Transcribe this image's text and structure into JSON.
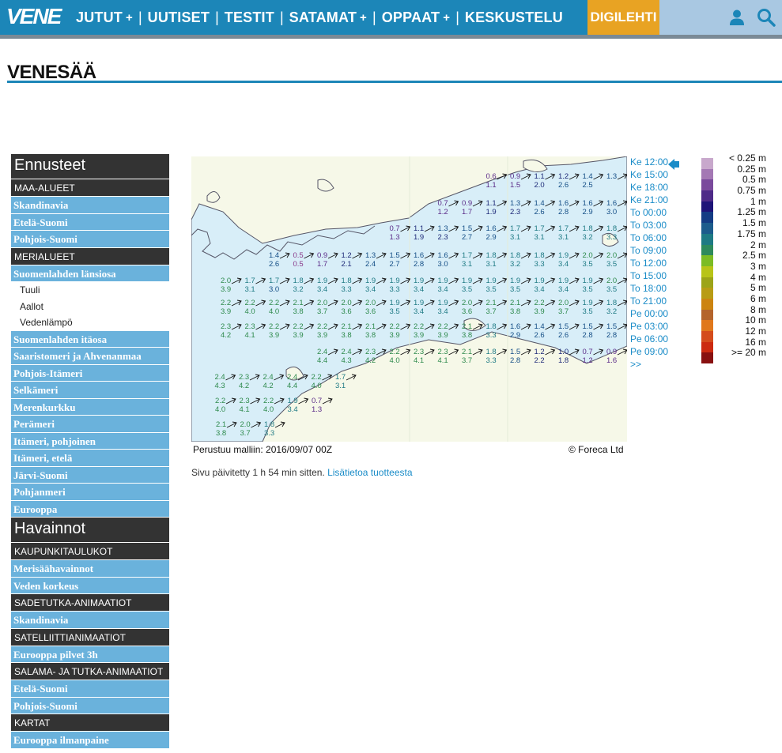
{
  "brand": {
    "logo_text": "VENE",
    "accent": "#1c86b8",
    "cta_color": "#e8a323"
  },
  "nav": {
    "items": [
      {
        "label": "JUTUT",
        "has_submenu": true
      },
      {
        "label": "UUTISET",
        "has_submenu": false
      },
      {
        "label": "TESTIT",
        "has_submenu": false
      },
      {
        "label": "SATAMAT",
        "has_submenu": true
      },
      {
        "label": "OPPAAT",
        "has_submenu": true
      },
      {
        "label": "KESKUSTELU",
        "has_submenu": false
      }
    ],
    "plus_glyph": "+",
    "separator": "|",
    "cta_label": "DIGILEHTI",
    "icons": [
      "user-icon",
      "search-icon"
    ]
  },
  "page": {
    "title": "VENESÄÄ"
  },
  "sidebar": {
    "items": [
      {
        "kind": "head",
        "label": "Ennusteet"
      },
      {
        "kind": "cat",
        "label": "MAA-ALUEET"
      },
      {
        "kind": "link",
        "label": "Skandinavia"
      },
      {
        "kind": "link",
        "label": "Etelä-Suomi"
      },
      {
        "kind": "link",
        "label": "Pohjois-Suomi"
      },
      {
        "kind": "cat",
        "label": "MERIALUEET"
      },
      {
        "kind": "link",
        "label": "Suomenlahden länsiosa"
      },
      {
        "kind": "sub",
        "label": "Tuuli"
      },
      {
        "kind": "sub",
        "label": "Aallot"
      },
      {
        "kind": "sub",
        "label": "Vedenlämpö"
      },
      {
        "kind": "link",
        "label": "Suomenlahden itäosa"
      },
      {
        "kind": "link",
        "label": "Saaristomeri ja Ahvenanmaa"
      },
      {
        "kind": "link",
        "label": "Pohjois-Itämeri"
      },
      {
        "kind": "link",
        "label": "Selkämeri"
      },
      {
        "kind": "link",
        "label": "Merenkurkku"
      },
      {
        "kind": "link",
        "label": "Perämeri"
      },
      {
        "kind": "link",
        "label": "Itämeri, pohjoinen"
      },
      {
        "kind": "link",
        "label": "Itämeri, etelä"
      },
      {
        "kind": "link",
        "label": "Järvi-Suomi"
      },
      {
        "kind": "link",
        "label": "Pohjanmeri"
      },
      {
        "kind": "link",
        "label": "Eurooppa"
      },
      {
        "kind": "head",
        "label": "Havainnot"
      },
      {
        "kind": "cat",
        "label": "KAUPUNKITAULUKOT"
      },
      {
        "kind": "link",
        "label": "Merisäähavainnot"
      },
      {
        "kind": "link",
        "label": "Veden korkeus"
      },
      {
        "kind": "cat",
        "label": "SADETUTKA-ANIMAATIOT"
      },
      {
        "kind": "link",
        "label": "Skandinavia"
      },
      {
        "kind": "cat",
        "label": "SATELLIITTIANIMAATIOT"
      },
      {
        "kind": "link",
        "label": "Eurooppa pilvet 3h"
      },
      {
        "kind": "cat",
        "label": "SALAMA- JA TUTKA-ANIMAATIOT"
      },
      {
        "kind": "link",
        "label": "Etelä-Suomi"
      },
      {
        "kind": "link",
        "label": "Pohjois-Suomi"
      },
      {
        "kind": "cat",
        "label": "KARTAT"
      },
      {
        "kind": "link",
        "label": "Eurooppa ilmanpaine"
      }
    ]
  },
  "forecast": {
    "selected_time": "Ke 12:00",
    "times": [
      "Ke 12:00",
      "Ke 15:00",
      "Ke 18:00",
      "Ke 21:00",
      "To 00:00",
      "To 03:00",
      "To 06:00",
      "To 09:00",
      "To 12:00",
      "To 15:00",
      "To 18:00",
      "To 21:00",
      "Pe 00:00",
      "Pe 03:00",
      "Pe 06:00",
      "Pe 09:00",
      ">>"
    ],
    "model_label": "Perustuu malliin: 2016/09/07 00Z",
    "copyright": "© Foreca Ltd",
    "updated_text": "Sivu päivitetty 1 h 54 min sitten.",
    "info_link": "Lisätietoa tuotteesta",
    "grid_rows": [
      {
        "cells": [
          [
            "0.6",
            "1.1"
          ],
          [
            "0.9",
            "1.5"
          ],
          [
            "1.1",
            "2.0"
          ],
          [
            "1.2",
            "2.6"
          ],
          [
            "1.4",
            "2.5"
          ],
          [
            "1.3",
            ""
          ]
        ]
      },
      {
        "cells": [
          [
            "0.7",
            "1.2"
          ],
          [
            "0.9",
            "1.7"
          ],
          [
            "1.1",
            "1.9"
          ],
          [
            "1.3",
            "2.3"
          ],
          [
            "1.4",
            "2.6"
          ],
          [
            "1.6",
            "2.8"
          ],
          [
            "1.6",
            "2.9"
          ],
          [
            "1.6",
            "3.0"
          ]
        ]
      },
      {
        "cells": [
          [
            "0.7",
            "1.3"
          ],
          [
            "1.1",
            "1.9"
          ],
          [
            "1.3",
            "2.3"
          ],
          [
            "1.5",
            "2.7"
          ],
          [
            "1.6",
            "2.9"
          ],
          [
            "1.7",
            "3.1"
          ],
          [
            "1.7",
            "3.1"
          ],
          [
            "1.7",
            "3.1"
          ],
          [
            "1.8",
            "3.2"
          ],
          [
            "1.8",
            "3.3"
          ]
        ]
      },
      {
        "cells": [
          [
            "1.4",
            "2.6"
          ],
          [
            "0.5",
            "0.5"
          ],
          [
            "0.9",
            "1.7"
          ],
          [
            "1.2",
            "2.1"
          ],
          [
            "1.3",
            "2.4"
          ],
          [
            "1.5",
            "2.7"
          ],
          [
            "1.6",
            "2.8"
          ],
          [
            "1.6",
            "3.0"
          ],
          [
            "1.7",
            "3.1"
          ],
          [
            "1.8",
            "3.1"
          ],
          [
            "1.8",
            "3.2"
          ],
          [
            "1.8",
            "3.3"
          ],
          [
            "1.9",
            "3.4"
          ],
          [
            "2.0",
            "3.5"
          ],
          [
            "2.0",
            "3.5"
          ]
        ]
      },
      {
        "cells": [
          [
            "2.0",
            "3.9"
          ],
          [
            "1.7",
            "3.1"
          ],
          [
            "1.7",
            "3.0"
          ],
          [
            "1.8",
            "3.2"
          ],
          [
            "1.9",
            "3.4"
          ],
          [
            "1.8",
            "3.3"
          ],
          [
            "1.9",
            "3.4"
          ],
          [
            "1.9",
            "3.3"
          ],
          [
            "1.9",
            "3.4"
          ],
          [
            "1.9",
            "3.4"
          ],
          [
            "1.9",
            "3.5"
          ],
          [
            "1.9",
            "3.5"
          ],
          [
            "1.9",
            "3.5"
          ],
          [
            "1.9",
            "3.4"
          ],
          [
            "1.9",
            "3.4"
          ],
          [
            "1.9",
            "3.5"
          ],
          [
            "2.0",
            "3.5"
          ]
        ]
      },
      {
        "cells": [
          [
            "2.2",
            "3.9"
          ],
          [
            "2.2",
            "4.0"
          ],
          [
            "2.2",
            "4.0"
          ],
          [
            "2.1",
            "3.8"
          ],
          [
            "2.0",
            "3.7"
          ],
          [
            "2.0",
            "3.6"
          ],
          [
            "2.0",
            "3.6"
          ],
          [
            "1.9",
            "3.5"
          ],
          [
            "1.9",
            "3.4"
          ],
          [
            "1.9",
            "3.4"
          ],
          [
            "2.0",
            "3.6"
          ],
          [
            "2.1",
            "3.7"
          ],
          [
            "2.1",
            "3.8"
          ],
          [
            "2.2",
            "3.9"
          ],
          [
            "2.0",
            "3.7"
          ],
          [
            "1.9",
            "3.5"
          ],
          [
            "1.8",
            "3.2"
          ]
        ]
      },
      {
        "cells": [
          [
            "2.3",
            "4.2"
          ],
          [
            "2.3",
            "4.1"
          ],
          [
            "2.2",
            "3.9"
          ],
          [
            "2.2",
            "3.9"
          ],
          [
            "2.2",
            "3.9"
          ],
          [
            "2.1",
            "3.8"
          ],
          [
            "2.1",
            "3.8"
          ],
          [
            "2.2",
            "3.9"
          ],
          [
            "2.2",
            "3.9"
          ],
          [
            "2.2",
            "3.9"
          ],
          [
            "2.1",
            "3.8"
          ],
          [
            "1.8",
            "3.3"
          ],
          [
            "1.6",
            "2.9"
          ],
          [
            "1.4",
            "2.6"
          ],
          [
            "1.5",
            "2.6"
          ],
          [
            "1.5",
            "2.8"
          ],
          [
            "1.5",
            "2.8"
          ]
        ]
      },
      {
        "cells": [
          [
            "2.4",
            "4.4"
          ],
          [
            "2.4",
            "4.3"
          ],
          [
            "2.3",
            "4.2"
          ],
          [
            "2.2",
            "4.0"
          ],
          [
            "2.3",
            "4.1"
          ],
          [
            "2.3",
            "4.1"
          ],
          [
            "2.1",
            "3.7"
          ],
          [
            "1.8",
            "3.3"
          ],
          [
            "1.5",
            "2.8"
          ],
          [
            "1.2",
            "2.2"
          ],
          [
            "1.0",
            "1.8"
          ],
          [
            "0.7",
            "1.2"
          ],
          [
            "0.9",
            "1.6"
          ]
        ]
      },
      {
        "cells": [
          [
            "2.4",
            "4.3"
          ],
          [
            "2.3",
            "4.2"
          ],
          [
            "2.4",
            "4.2"
          ],
          [
            "2.4",
            "4.4"
          ],
          [
            "2.2",
            "4.0"
          ],
          [
            "1.7",
            "3.1"
          ]
        ]
      },
      {
        "cells": [
          [
            "2.2",
            "4.0"
          ],
          [
            "2.3",
            "4.1"
          ],
          [
            "2.2",
            "4.0"
          ],
          [
            "1.9",
            "3.4"
          ],
          [
            "0.7",
            "1.3"
          ]
        ]
      },
      {
        "cells": [
          [
            "2.1",
            "3.8"
          ],
          [
            "2.0",
            "3.7"
          ],
          [
            "1.8",
            "3.3"
          ]
        ]
      }
    ]
  },
  "legend": {
    "entries": [
      {
        "label": "< 0.25 m",
        "color": "#c8a8cc"
      },
      {
        "label": "0.25 m",
        "color": "#a478b4"
      },
      {
        "label": "0.5 m",
        "color": "#7a4a9c"
      },
      {
        "label": "0.75 m",
        "color": "#4e2a88"
      },
      {
        "label": "1 m",
        "color": "#1e1478"
      },
      {
        "label": "1.25 m",
        "color": "#143c84"
      },
      {
        "label": "1.5 m",
        "color": "#1c5c8c"
      },
      {
        "label": "1.75 m",
        "color": "#1e7a84"
      },
      {
        "label": "2 m",
        "color": "#2e8a5c"
      },
      {
        "label": "2.5 m",
        "color": "#7cbc24"
      },
      {
        "label": "3 m",
        "color": "#b8c418"
      },
      {
        "label": "4 m",
        "color": "#9ca418"
      },
      {
        "label": "5 m",
        "color": "#b89c14"
      },
      {
        "label": "6 m",
        "color": "#cc8410"
      },
      {
        "label": "8 m",
        "color": "#b4642c"
      },
      {
        "label": "10 m",
        "color": "#e0781c"
      },
      {
        "label": "12 m",
        "color": "#d44c1c"
      },
      {
        "label": "16 m",
        "color": "#cc2a10"
      },
      {
        "label": ">= 20 m",
        "color": "#881010"
      }
    ]
  }
}
